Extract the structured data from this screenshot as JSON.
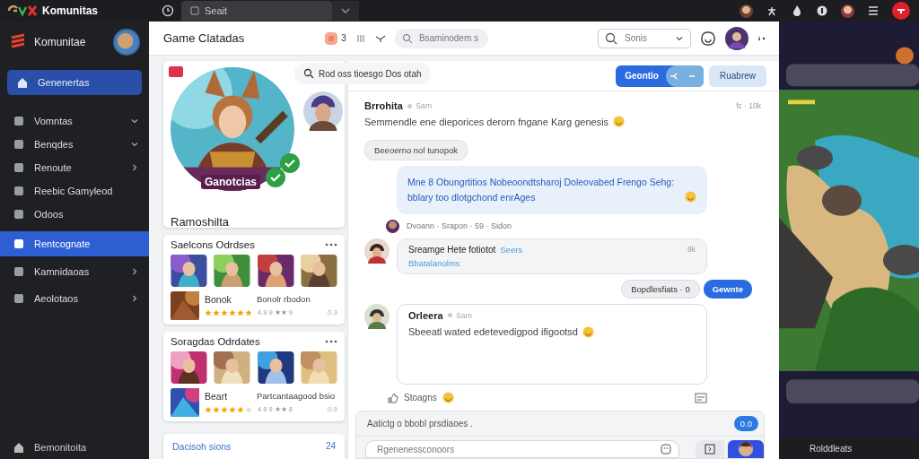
{
  "topbar": {
    "brand": "Komunitas",
    "tab": "Seait"
  },
  "sidebar": {
    "brand": "Komunitae",
    "primary": "Genenertas",
    "items": [
      {
        "label": "Vomntas",
        "expanded": true,
        "selected": false
      },
      {
        "label": "Benqdes",
        "expanded": true,
        "selected": false
      },
      {
        "label": "Renoute",
        "expanded": false,
        "selected": false
      },
      {
        "label": "Reebic Gamyleod",
        "selected": false
      },
      {
        "label": "Odoos",
        "selected": false
      },
      {
        "label": "Rentcognate",
        "selected": true
      },
      {
        "label": "Kamnidaoas",
        "expanded": false,
        "selected": false
      },
      {
        "label": "Aeolotaos",
        "expanded": false,
        "selected": false
      }
    ],
    "footer": "Bemonitoita"
  },
  "header": {
    "title": "Game Clatadas",
    "badge": "3",
    "search": {
      "placeholder": "Bsaminodem s"
    },
    "filter": {
      "placeholder": "Sonis"
    }
  },
  "profile": {
    "banner": "Ganotcias",
    "name": "Ramoshilta"
  },
  "lists": [
    {
      "title": "Saelcons Odrdses",
      "featured": {
        "name": "Bonok",
        "subtitle": "Bonolr rbodon",
        "stars": 6,
        "meta": "4.9 9 ★★ 9",
        "count": "0.3"
      }
    },
    {
      "title": "Soragdas Odrdates",
      "featured": {
        "name": "Beart",
        "subtitle": "Partcantaagood bsio",
        "stars": 5,
        "meta": "4.9 9 ★★ 8",
        "count": "0.9"
      }
    }
  ],
  "link": {
    "label": "Dacisoh sions",
    "count": "24"
  },
  "toolbar": {
    "hint": "Rod oss  tioesgo Dos otah",
    "primary": "Geontio",
    "secondary": "Ruabrew"
  },
  "messages": [
    {
      "kind": "post",
      "author": "Brrohita",
      "time": "5am",
      "text": "Semmendle ene dieporices derorn fngane Karg genesis",
      "emoji": true,
      "meta": "fc · 10k"
    },
    {
      "kind": "chip",
      "text": "Beeoerno nol tunopok"
    },
    {
      "kind": "bubble",
      "text": "Mne 8 Obungrtitios Nobeoondtsharoj Doleovabed Frengo Sehg: bblary too dlotgchond enrAges",
      "emoji": true
    },
    {
      "kind": "meta",
      "text": "Dvoann · Srapon · 59 · Sidon"
    },
    {
      "kind": "card",
      "text": "Sreamge Hete fotiotot",
      "link": "Seers",
      "meta": "9k",
      "sub": "Bbatalanolms"
    },
    {
      "kind": "action",
      "text": "Bopdlesfiats · 0",
      "button": "Gewnte"
    },
    {
      "kind": "post-box",
      "author": "Orleera",
      "time": "6am",
      "text": "Sbeeatl wated edetevedigpod ifigootsd",
      "emoji": true
    },
    {
      "kind": "reaction",
      "text": "Stoagns",
      "emoji": true
    }
  ],
  "composer": {
    "prompt": "Aatictg o bbobl prsdiaoes .",
    "count": "0.0",
    "placeholder": "Rgenenessconoors"
  },
  "overlay": {
    "footer": "Rolddleats"
  }
}
